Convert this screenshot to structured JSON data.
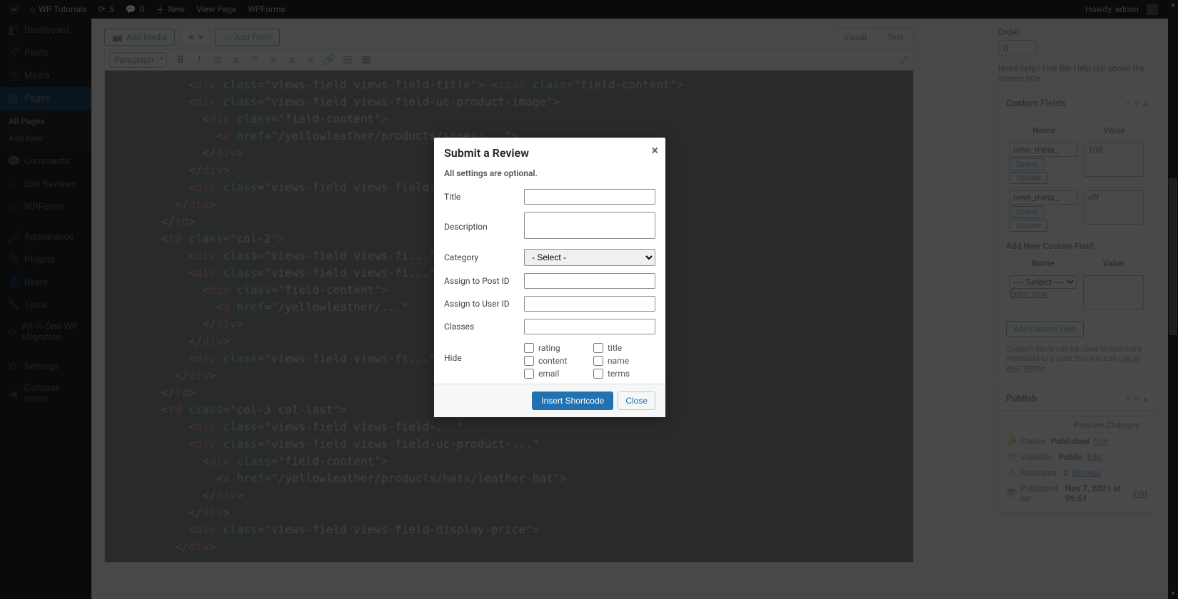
{
  "adminbar": {
    "site_title": "WP Tutorials",
    "updates_count": "5",
    "comments_count": "0",
    "new_label": "New",
    "view_page": "View Page",
    "wpforms": "WPForms",
    "howdy": "Howdy, admin"
  },
  "sidemenu": {
    "dashboard": "Dashboard",
    "posts": "Posts",
    "media": "Media",
    "pages": "Pages",
    "pages_sub": {
      "all": "All Pages",
      "add": "Add New"
    },
    "comments": "Comments",
    "site_reviews": "Site Reviews",
    "wpforms": "WPForms",
    "appearance": "Appearance",
    "plugins": "Plugins",
    "users": "Users",
    "tools": "Tools",
    "migration": "All-in-One WP Migration",
    "settings": "Settings",
    "collapse": "Collapse menu"
  },
  "editor": {
    "add_media": "Add Media",
    "add_form": "Add Form",
    "tab_visual": "Visual",
    "tab_text": "Text",
    "format_select": "Paragraph"
  },
  "meta": {
    "order_label": "Order",
    "order_value": "0",
    "help_text": "Need help? Use the Help tab above the screen title.",
    "custom_fields": {
      "title": "Custom Fields",
      "th_name": "Name",
      "th_value": "Value",
      "rows": [
        {
          "name": "neve_meta_",
          "value": "100"
        },
        {
          "name": "neve_meta_",
          "value": "off"
        }
      ],
      "delete": "Delete",
      "update": "Update",
      "add_new_label": "Add New Custom Field:",
      "select_placeholder": "— Select —",
      "enter_new": "Enter new",
      "add_btn": "Add Custom Field",
      "note_pre": "Custom fields can be used to add extra metadata to a post that you can ",
      "note_link": "use in your theme",
      "note_post": "."
    },
    "publish": {
      "title": "Publish",
      "preview": "Preview Changes",
      "status_label": "Status:",
      "status_value": "Published",
      "visibility_label": "Visibility:",
      "visibility_value": "Public",
      "revisions_label": "Revisions:",
      "revisions_value": "2",
      "browse": "Browse",
      "published_on_label": "Published on:",
      "published_on_value": "Nov 7, 2021 at 09:51",
      "edit": "Edit"
    }
  },
  "modal": {
    "title": "Submit a Review",
    "note": "All settings are optional.",
    "labels": {
      "title": "Title",
      "description": "Description",
      "category": "Category",
      "assign_post": "Assign to Post ID",
      "assign_user": "Assign to User ID",
      "classes": "Classes",
      "hide": "Hide"
    },
    "category_selected": "- Select -",
    "hide_opts": {
      "rating": "rating",
      "title": "title",
      "content": "content",
      "name": "name",
      "email": "email",
      "terms": "terms"
    },
    "insert": "Insert Shortcode",
    "close": "Close"
  }
}
